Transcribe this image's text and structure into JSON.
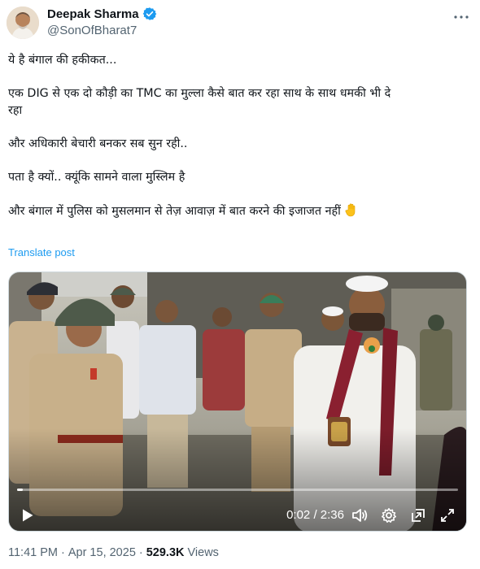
{
  "author": {
    "display_name": "Deepak Sharma",
    "handle": "@SonOfBharat7",
    "verified_icon": "verified-badge-icon",
    "accent": "#1d9bf0"
  },
  "post": {
    "lines": [
      "ये है बंगाल की हकीकत...",
      "एक DIG से एक दो कौड़ी का TMC का मुल्ला कैसे बात कर रहा साथ के साथ धमकी भी दे\nरहा",
      "और अधिकारी बेचारी बनकर सब सुन रही..",
      "पता है क्यों.. क्यूंकि सामने वाला मुस्लिम है",
      "और बंगाल में पुलिस को मुसलमान से तेज़ आवाज़ में बात करने की इजाजत नहीं"
    ],
    "emoji": "raised-hand-icon",
    "translate_label": "Translate post"
  },
  "video": {
    "current_time": "0:02",
    "duration": "2:36",
    "time_separator": " / ",
    "progress_fraction": 0.013,
    "icons": [
      "play-icon",
      "volume-icon",
      "settings-icon",
      "pip-icon",
      "fullscreen-icon"
    ]
  },
  "meta": {
    "time": "11:41 PM",
    "date": "Apr 15, 2025",
    "separator": "·",
    "views_count": "529.3K",
    "views_label": "Views"
  }
}
